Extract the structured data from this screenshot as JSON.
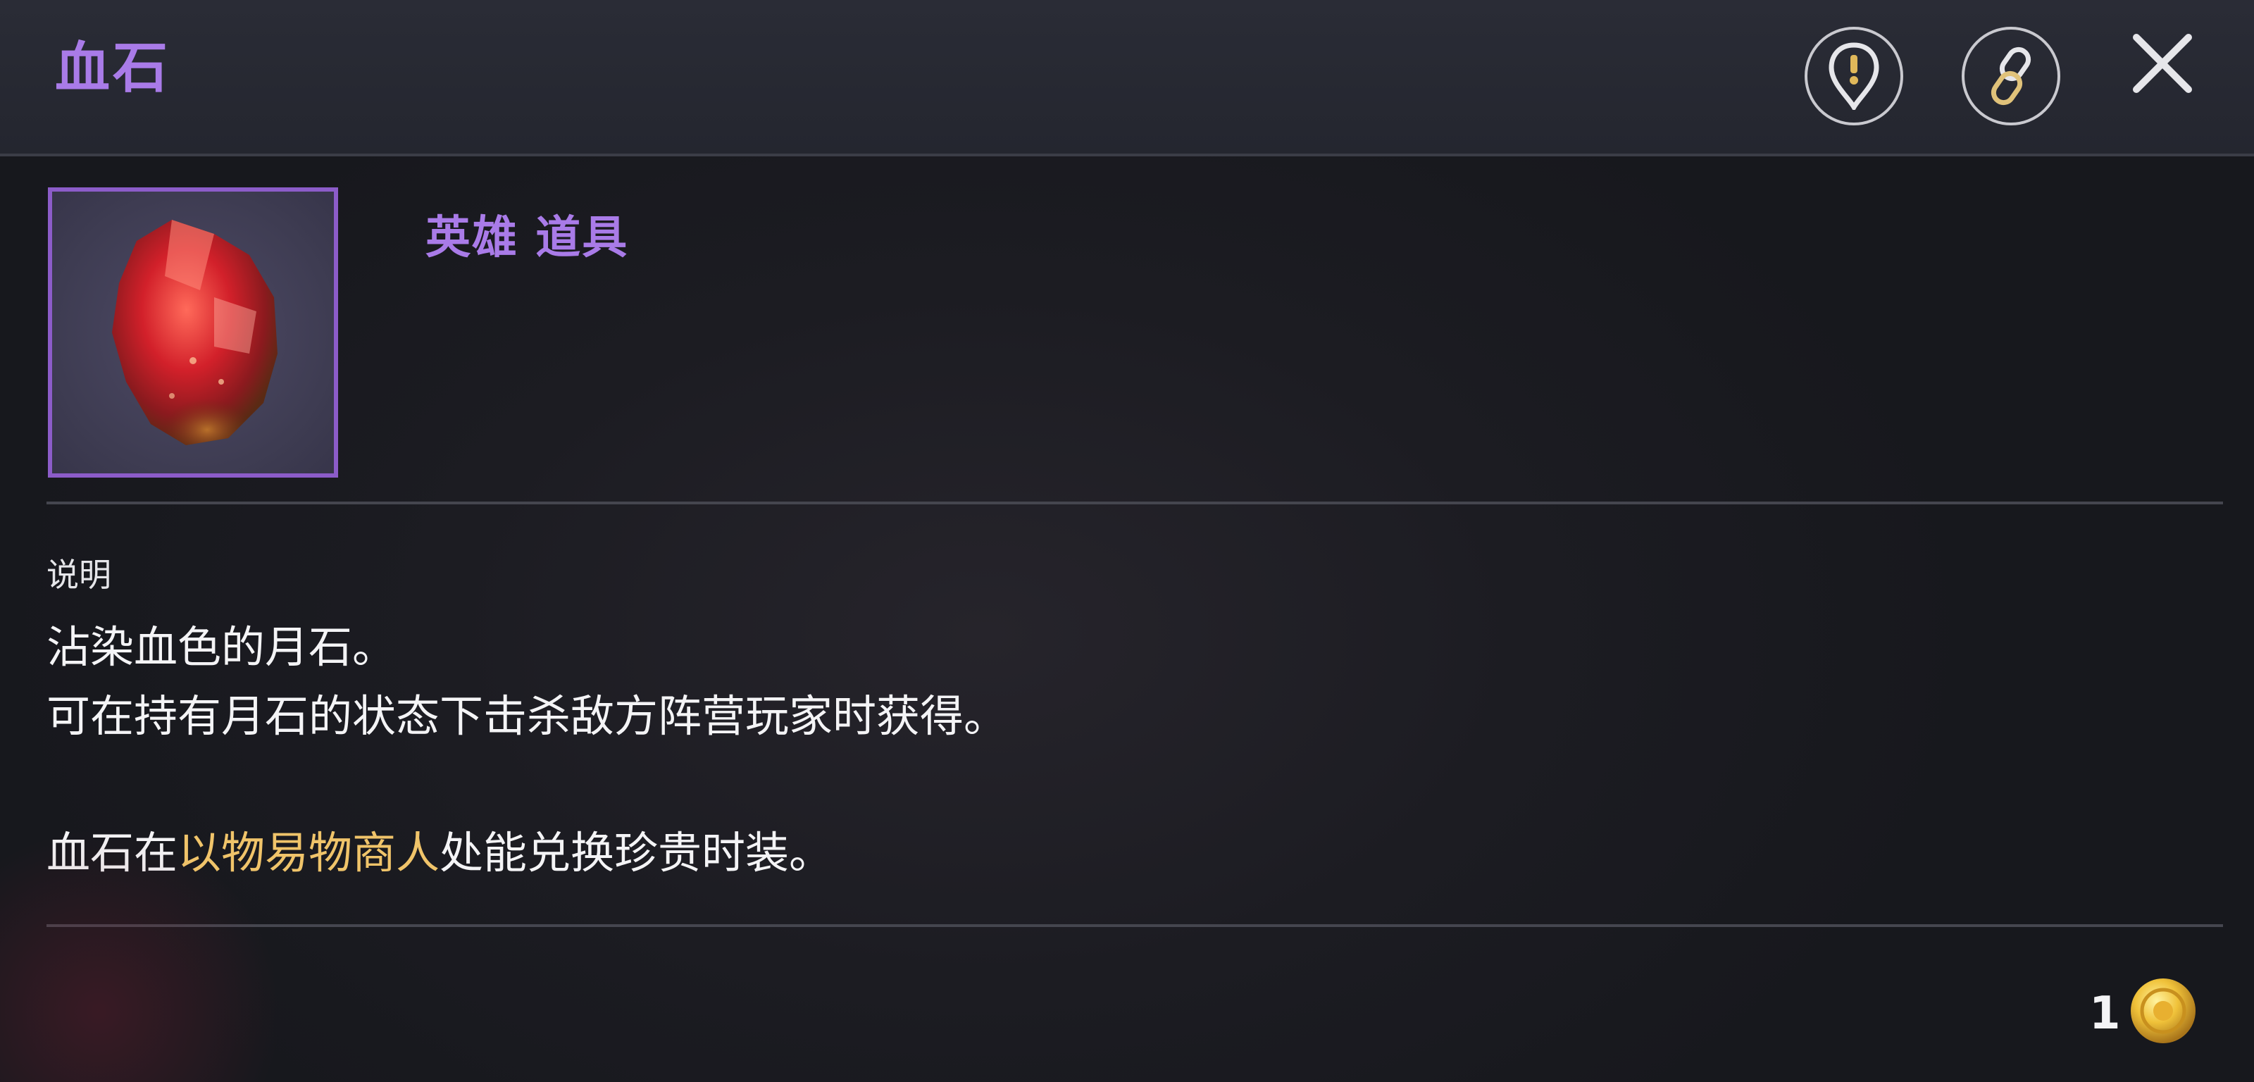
{
  "header": {
    "title": "血石",
    "report_icon": "report-pin-icon",
    "link_icon": "link-icon",
    "close_icon": "close-icon"
  },
  "item": {
    "image_icon": "blood-stone-icon",
    "rarity_label": "英雄 道具"
  },
  "description": {
    "section_label": "说明",
    "line1": "沾染血色的月石。",
    "line2": "可在持有月石的状态下击杀敌方阵营玩家时获得。",
    "line3_prefix": "血石在",
    "line3_highlight": "以物易物商人",
    "line3_suffix": "处能兑换珍贵时装。"
  },
  "footer": {
    "quantity": "1",
    "coin_icon": "gold-coin-icon"
  },
  "colors": {
    "title": "#a97be8",
    "highlight": "#f0c46a",
    "frame": "#8c5cc9"
  }
}
